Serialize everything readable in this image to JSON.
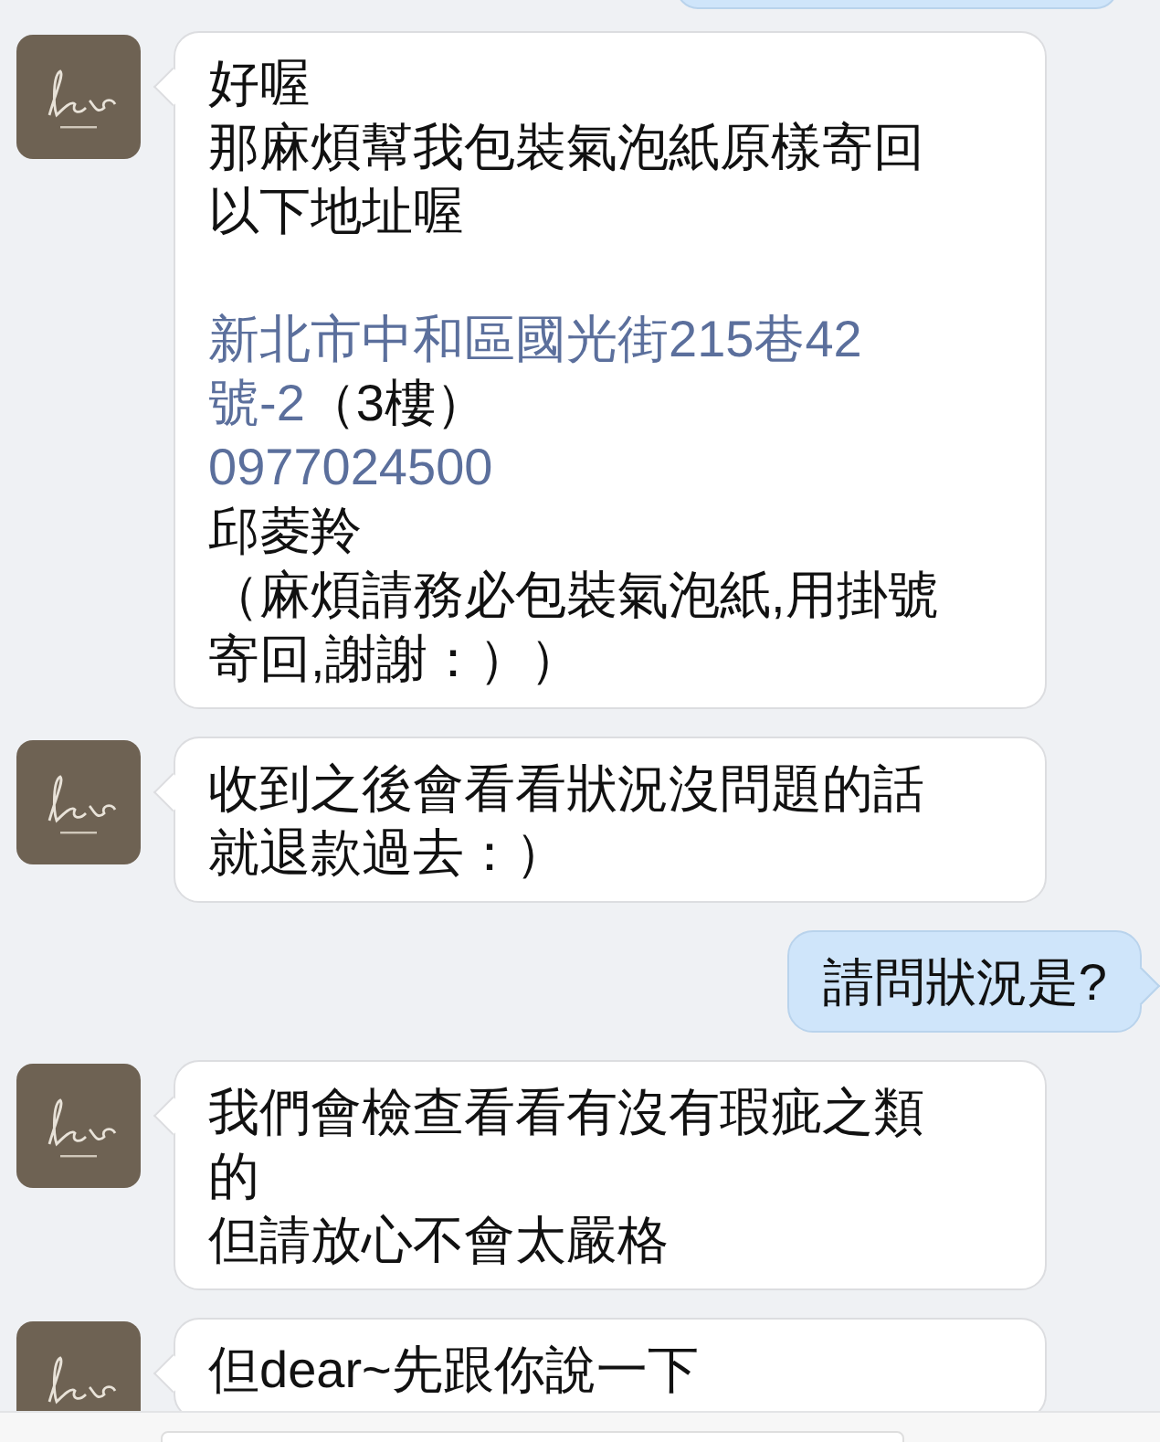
{
  "messages": [
    {
      "kind": "incoming",
      "paragraphs": [
        [
          [
            {
              "text": "好喔",
              "link": false
            }
          ],
          [
            {
              "text": "那麻煩幫我包裝氣泡紙原樣寄回",
              "link": false
            }
          ],
          [
            {
              "text": "以下地址喔",
              "link": false
            }
          ]
        ],
        [
          [
            {
              "text": "新北市中和區國光街215巷42",
              "link": true
            }
          ],
          [
            {
              "text": "號-2",
              "link": true
            },
            {
              "text": "（3樓）",
              "link": false
            }
          ],
          [
            {
              "text": "0977024500",
              "link": true
            }
          ],
          [
            {
              "text": "邱菱羚",
              "link": false
            }
          ],
          [
            {
              "text": "（麻煩請務必包裝氣泡紙,用掛號",
              "link": false
            }
          ],
          [
            {
              "text": "寄回,謝謝：））",
              "link": false
            }
          ]
        ]
      ]
    },
    {
      "kind": "incoming",
      "paragraphs": [
        [
          [
            {
              "text": "收到之後會看看狀況沒問題的話",
              "link": false
            }
          ],
          [
            {
              "text": "就退款過去：）",
              "link": false
            }
          ]
        ]
      ]
    },
    {
      "kind": "outgoing",
      "paragraphs": [
        [
          [
            {
              "text": "請問狀況是?",
              "link": false
            }
          ]
        ]
      ]
    },
    {
      "kind": "incoming",
      "paragraphs": [
        [
          [
            {
              "text": "我們會檢查看看有沒有瑕疵之類",
              "link": false
            }
          ],
          [
            {
              "text": "的",
              "link": false
            }
          ],
          [
            {
              "text": "但請放心不會太嚴格",
              "link": false
            }
          ]
        ]
      ]
    },
    {
      "kind": "incoming",
      "paragraphs": [
        [
          [
            {
              "text": "但dear~先跟你說一下",
              "link": false
            }
          ]
        ]
      ]
    }
  ]
}
